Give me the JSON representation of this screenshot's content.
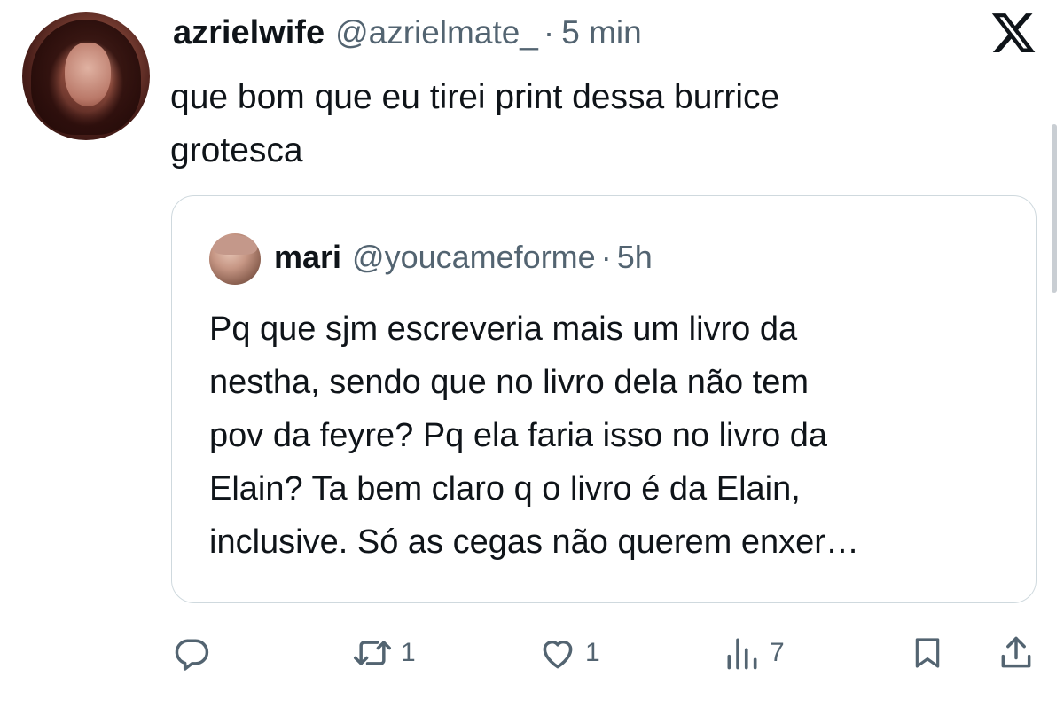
{
  "tweet": {
    "author": {
      "display_name": "azrielwife",
      "handle": "@azrielmate_",
      "separator": "·",
      "time": "5 min"
    },
    "text_lines": [
      "que bom que eu tirei print dessa burrice",
      "grotesca"
    ],
    "platform_logo": "x-logo-icon"
  },
  "quoted_tweet": {
    "author": {
      "display_name": "mari",
      "handle": "@youcameforme",
      "separator": "·",
      "time": "5h"
    },
    "text_lines": [
      "Pq que sjm escreveria mais um livro da",
      "nestha, sendo que no livro dela não tem",
      "pov da feyre? Pq ela faria isso no livro da",
      "Elain? Ta bem claro q o livro é da Elain,",
      "inclusive. Só as cegas não querem enxer…"
    ]
  },
  "actions": {
    "reply": {
      "icon": "reply-icon",
      "count": ""
    },
    "repost": {
      "icon": "repost-icon",
      "count": "1"
    },
    "like": {
      "icon": "heart-icon",
      "count": "1"
    },
    "views": {
      "icon": "views-icon",
      "count": "7"
    },
    "bookmark": {
      "icon": "bookmark-icon"
    },
    "share": {
      "icon": "share-icon"
    }
  },
  "colors": {
    "text_primary": "#0f1419",
    "text_secondary": "#536471",
    "border": "#cfd9de",
    "background": "#ffffff"
  }
}
